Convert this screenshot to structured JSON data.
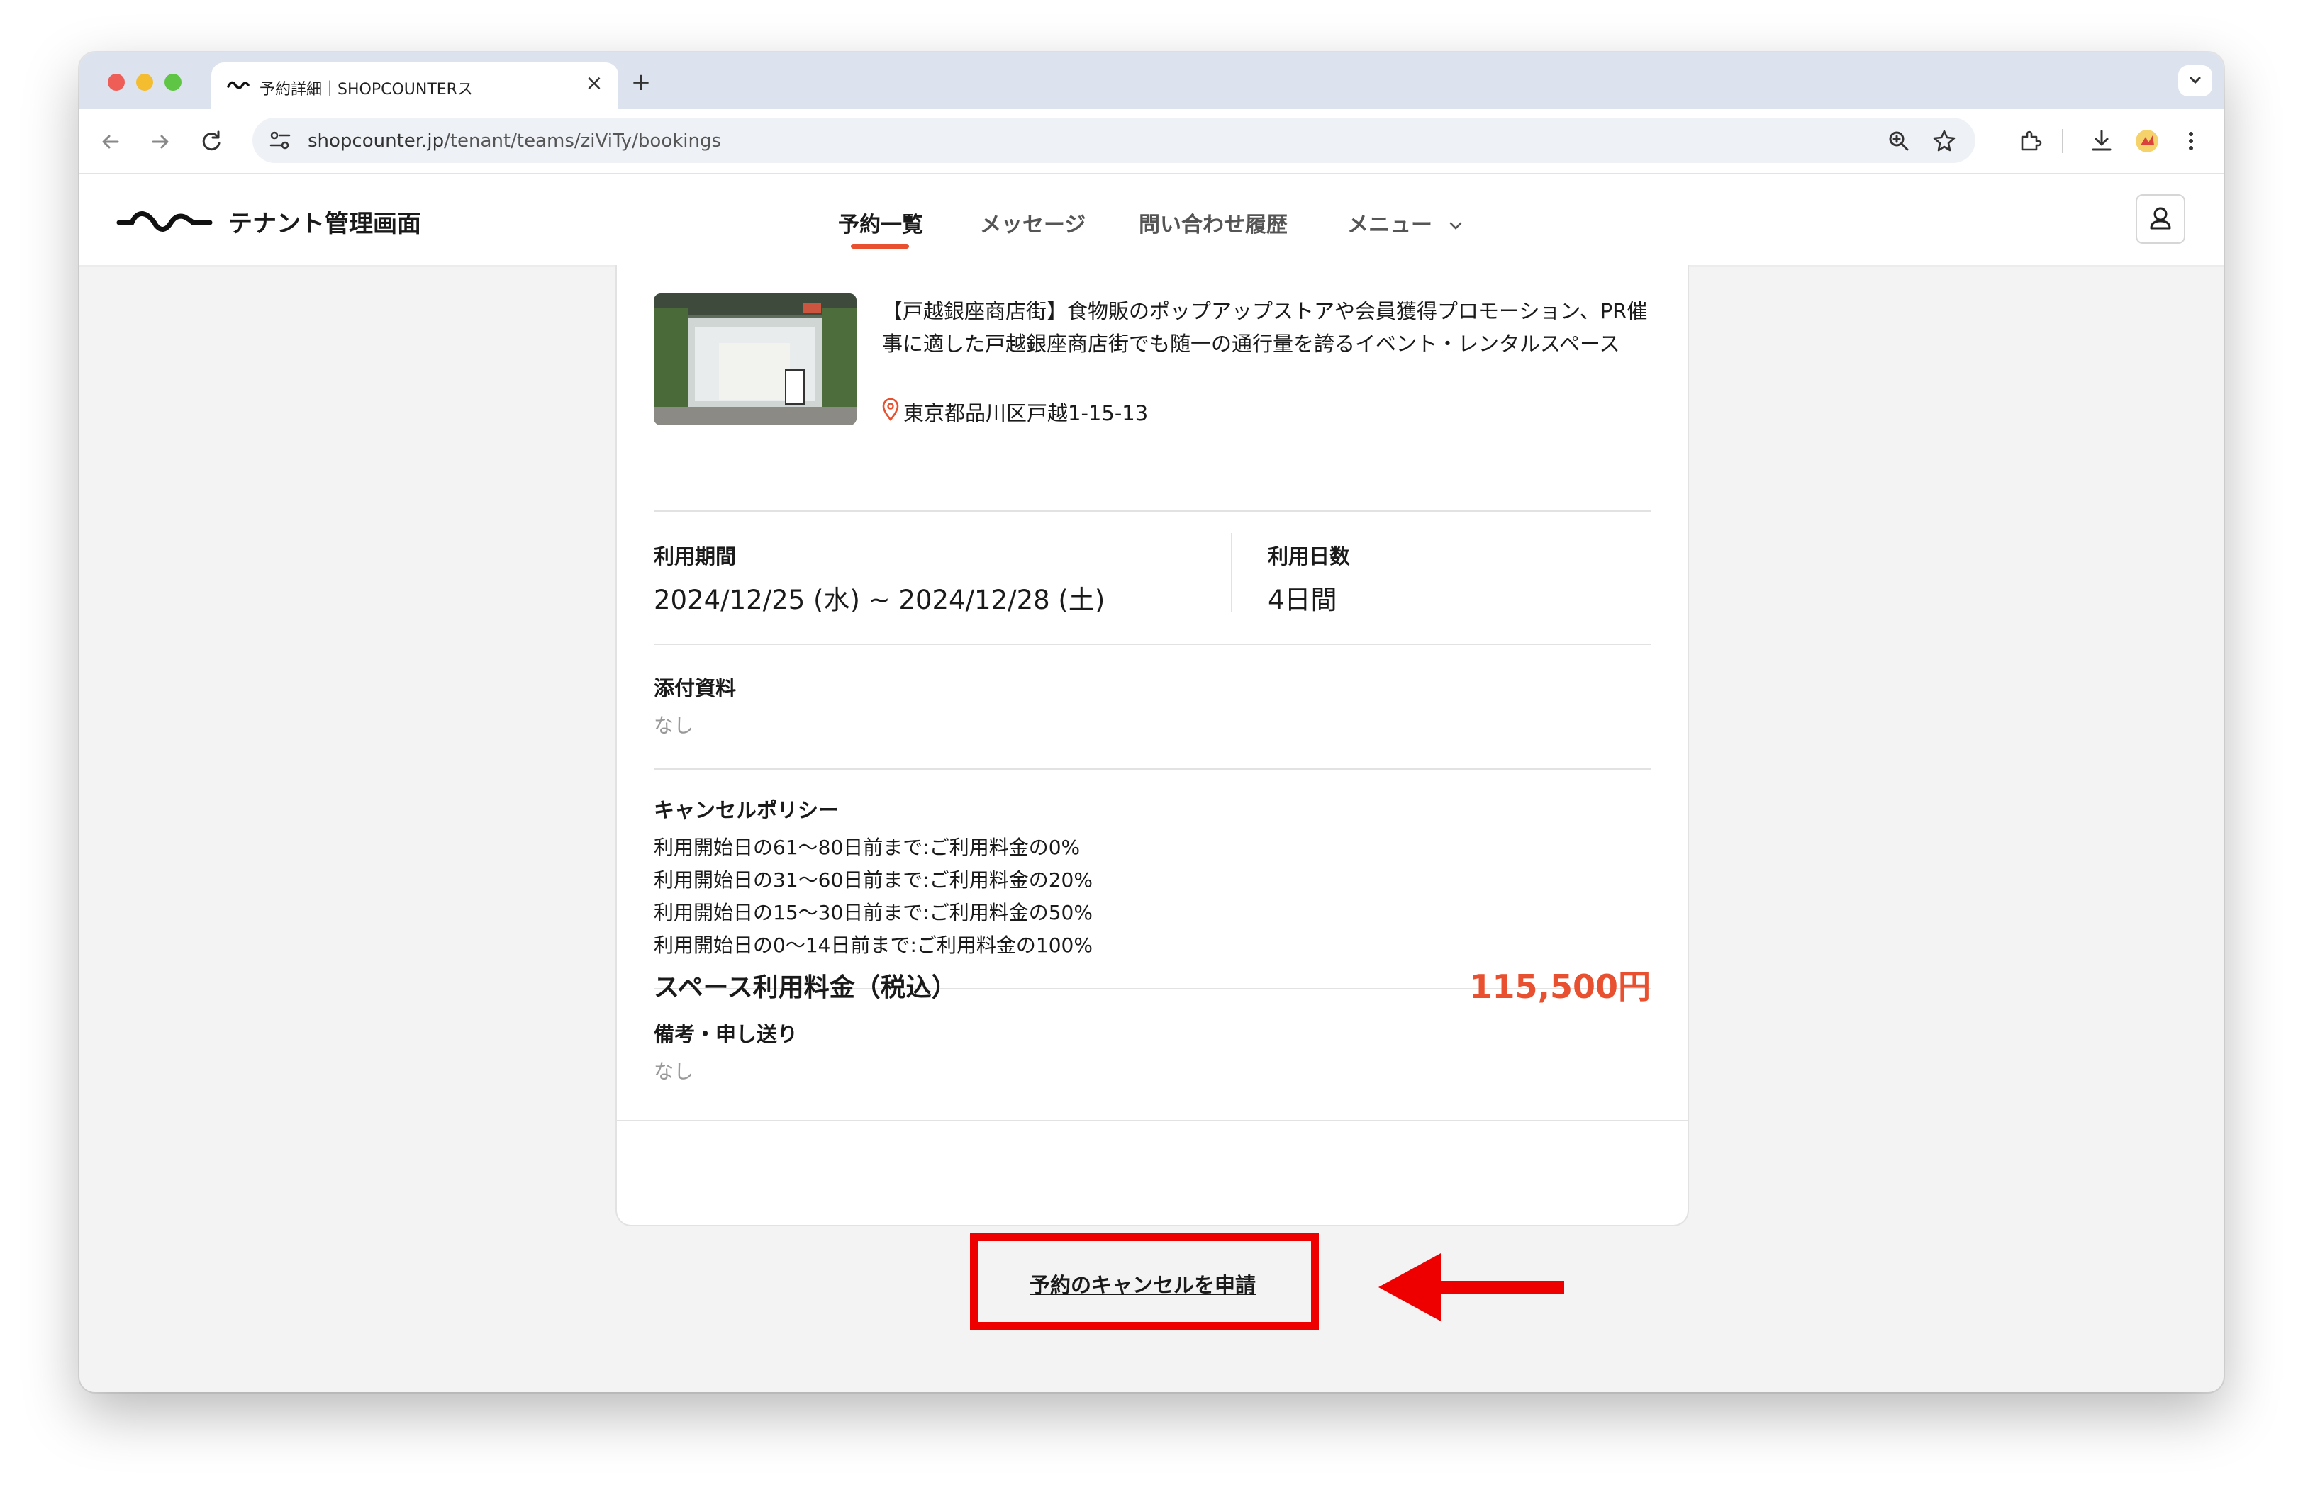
{
  "browser": {
    "tab_title": "予約詳細｜SHOPCOUNTERス",
    "url_host": "shopcounter.jp",
    "url_path": "/tenant/teams/ziViTy/bookings"
  },
  "header": {
    "brand": "テナント管理画面",
    "nav": [
      {
        "label": "予約一覧",
        "active": true
      },
      {
        "label": "メッセージ"
      },
      {
        "label": "問い合わせ履歴"
      },
      {
        "label": "メニュー"
      }
    ]
  },
  "space": {
    "title": "【戸越銀座商店街】食物販のポップアップストアや会員獲得プロモーション、PR催事に適した戸越銀座商店街でも随一の通行量を誇るイベント・レンタルスペース",
    "address": "東京都品川区戸越1-15-13"
  },
  "booking": {
    "period_label": "利用期間",
    "period_value": "2024/12/25 (水) ~ 2024/12/28 (土)",
    "days_label": "利用日数",
    "days_value": "4日間",
    "attachments_label": "添付資料",
    "attachments_value": "なし",
    "policy_label": "キャンセルポリシー",
    "policy_lines": [
      "利用開始日の61〜80日前まで:ご利用料金の0%",
      "利用開始日の31〜60日前まで:ご利用料金の20%",
      "利用開始日の15〜30日前まで:ご利用料金の50%",
      "利用開始日の0〜14日前まで:ご利用料金の100%"
    ],
    "notes_label": "備考・申し送り",
    "notes_value": "なし"
  },
  "total": {
    "label": "スペース利用料金（税込）",
    "price": "115,500円"
  },
  "actions": {
    "cancel_request": "予約のキャンセルを申請"
  },
  "colors": {
    "accent": "#e8502f",
    "annotation": "#ee0000"
  }
}
